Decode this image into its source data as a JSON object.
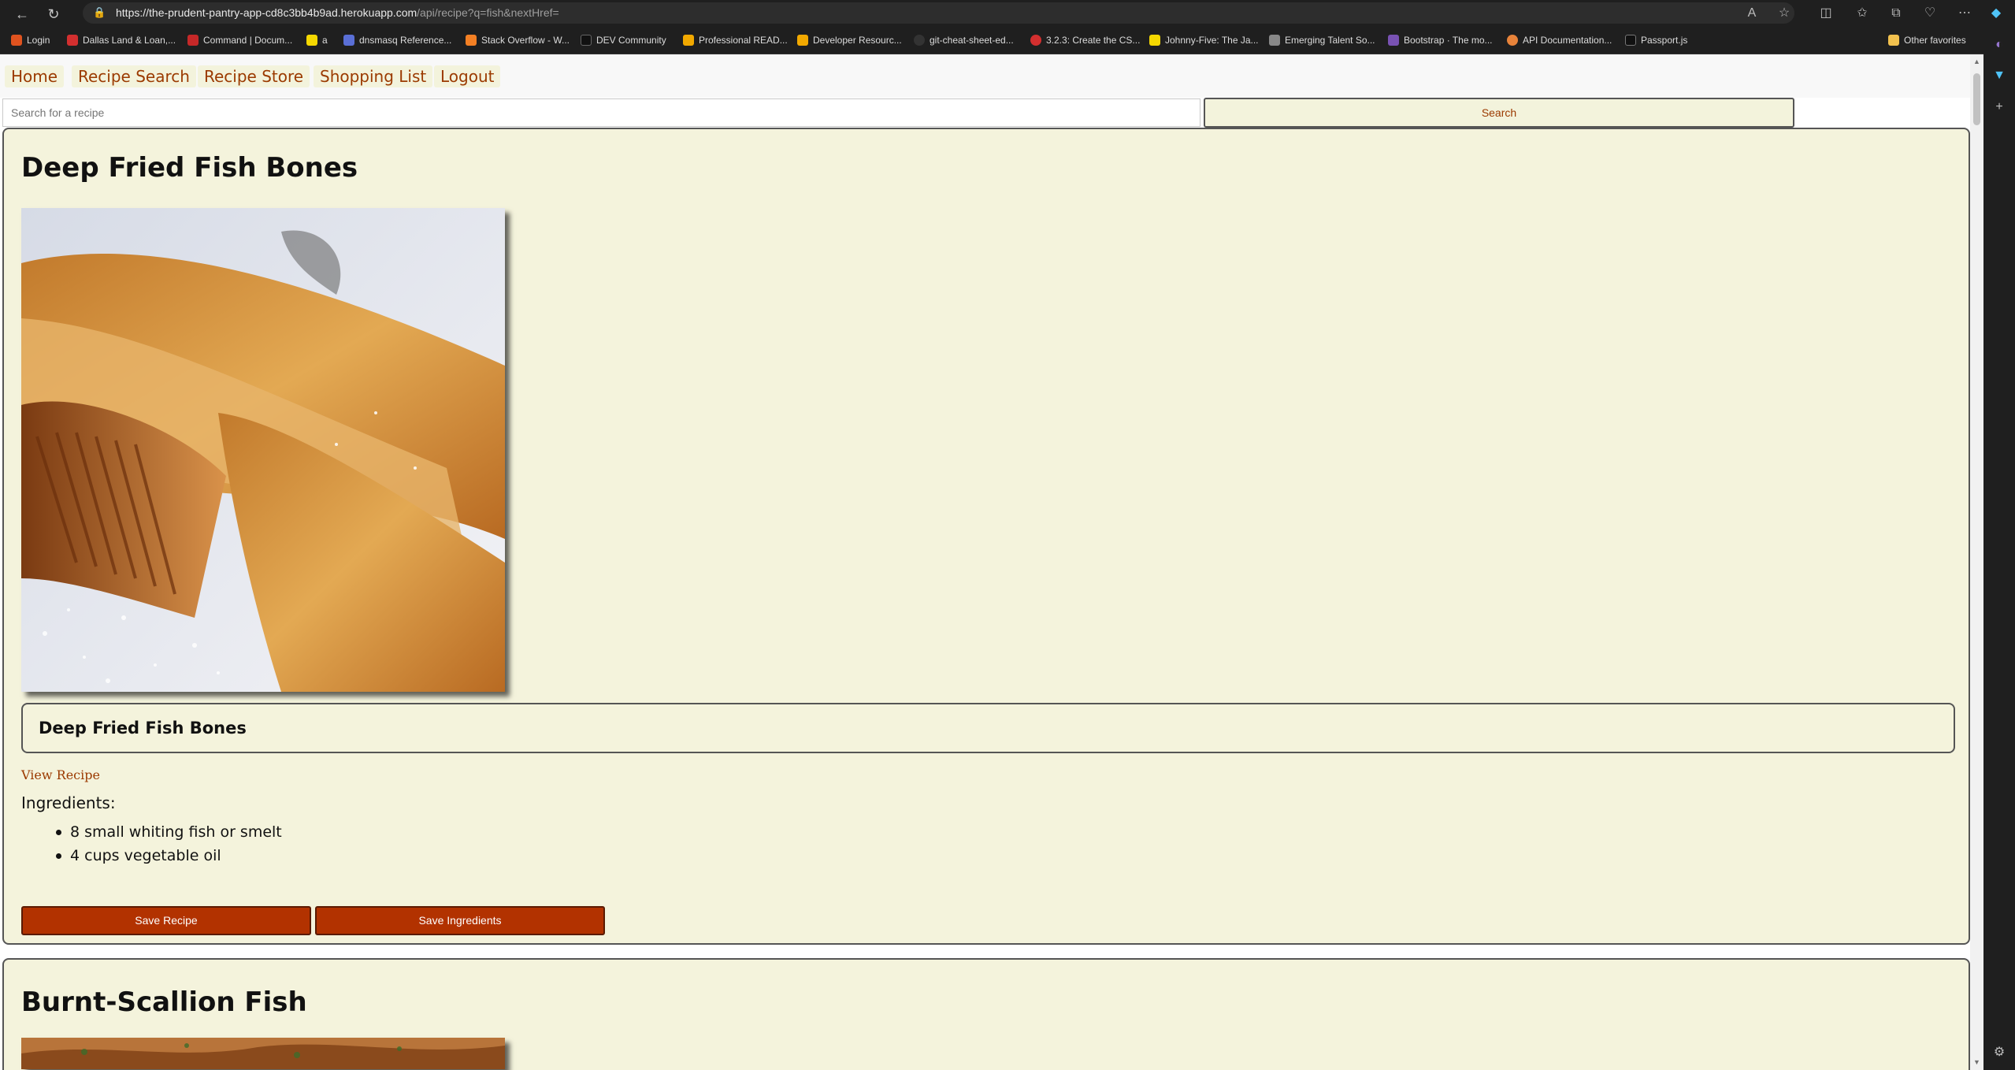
{
  "browser": {
    "url_host": "https://the-prudent-pantry-app-cd8c3bb4b9ad.herokuapp.com",
    "url_path": "/api/recipe?q=fish&nextHref=",
    "bookmarks": [
      {
        "label": "Login",
        "color": "#e0531f"
      },
      {
        "label": "Dallas Land & Loan,...",
        "color": "#d32f2f"
      },
      {
        "label": "Command | Docum...",
        "color": "#c62828"
      },
      {
        "label": "a",
        "color": "#f5d800"
      },
      {
        "label": "dnsmasq Reference...",
        "color": "#5a6fd6"
      },
      {
        "label": "Stack Overflow - W...",
        "color": "#f48024"
      },
      {
        "label": "DEV Community",
        "color": "#111111"
      },
      {
        "label": "Professional READ...",
        "color": "#f2a900"
      },
      {
        "label": "Developer Resourc...",
        "color": "#f2a900"
      },
      {
        "label": "git-cheat-sheet-ed...",
        "color": "#333333"
      },
      {
        "label": "3.2.3: Create the CS...",
        "color": "#d32f2f"
      },
      {
        "label": "Johnny-Five: The Ja...",
        "color": "#f5d800"
      },
      {
        "label": "Emerging Talent So...",
        "color": "#888888"
      },
      {
        "label": "Bootstrap · The mo...",
        "color": "#7952b3"
      },
      {
        "label": "API Documentation...",
        "color": "#e8833a"
      },
      {
        "label": "Passport.js",
        "color": "#111111"
      }
    ],
    "other_favorites": "Other favorites"
  },
  "nav": {
    "home": "Home",
    "recipe_search": "Recipe Search",
    "recipe_store": "Recipe Store",
    "shopping_list": "Shopping List",
    "logout": "Logout"
  },
  "search": {
    "placeholder": "Search for a recipe",
    "button": "Search"
  },
  "recipes": [
    {
      "title": "Deep Fried Fish Bones",
      "label": "Deep Fried Fish Bones",
      "view_link": "View Recipe",
      "ingredients_label": "Ingredients:",
      "ingredients": [
        "8 small whiting fish or smelt",
        "4 cups vegetable oil"
      ],
      "save_recipe": "Save Recipe",
      "save_ingredients": "Save Ingredients"
    },
    {
      "title": "Burnt-Scallion Fish"
    }
  ],
  "colors": {
    "accent": "#9b3a00",
    "card_bg": "#f4f3dc",
    "button_bg": "#b23200"
  }
}
